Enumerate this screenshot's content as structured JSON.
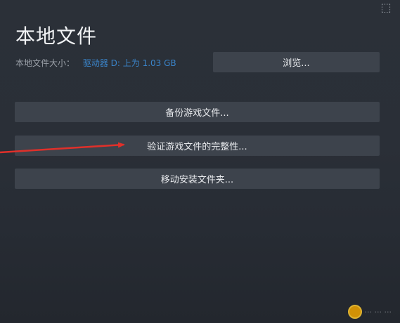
{
  "header": {
    "title": "本地文件",
    "close_glyph": "⬚"
  },
  "disk_info": {
    "label": "本地文件大小：",
    "value": "驱动器 D: 上为 1.03 GB"
  },
  "buttons": {
    "browse": "浏览...",
    "backup": "备份游戏文件...",
    "verify": "验证游戏文件的完整性...",
    "move": "移动安装文件夹..."
  },
  "annotation": {
    "arrow_color": "#e0302a"
  },
  "watermark": {
    "text": "··· ··· ···"
  }
}
